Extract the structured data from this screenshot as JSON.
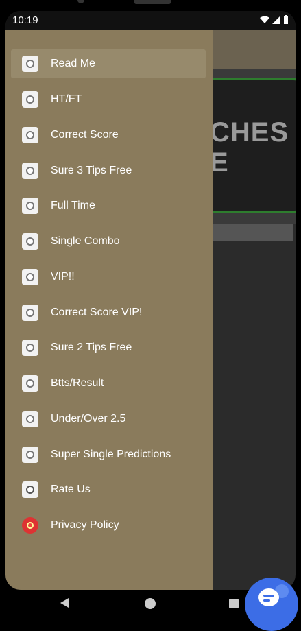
{
  "status_bar": {
    "time": "10:19",
    "wifi_icon": "wifi-icon",
    "signal_icon": "signal-icon",
    "battery_icon": "battery-icon"
  },
  "background": {
    "banner_text": "CHES\nE"
  },
  "drawer": {
    "items": [
      {
        "label": "Read Me",
        "icon": "read-icon",
        "active": true
      },
      {
        "label": "HT/FT",
        "icon": "ball-icon"
      },
      {
        "label": "Correct Score",
        "icon": "ball-icon"
      },
      {
        "label": "Sure 3 Tips Free",
        "icon": "ball-icon"
      },
      {
        "label": "Full Time",
        "icon": "ball-icon"
      },
      {
        "label": "Single Combo",
        "icon": "ball-icon"
      },
      {
        "label": "VIP!!",
        "icon": "ball-icon"
      },
      {
        "label": "Correct Score VIP!",
        "icon": "ball-icon"
      },
      {
        "label": "Sure 2 Tips Free",
        "icon": "ball-icon"
      },
      {
        "label": "Btts/Result",
        "icon": "ball-icon"
      },
      {
        "label": "Under/Over 2.5",
        "icon": "ball-icon"
      },
      {
        "label": "Super Single Predictions",
        "icon": "ball-icon"
      },
      {
        "label": "Rate Us",
        "icon": "rate-icon"
      },
      {
        "label": "Privacy Policy",
        "icon": "privacy-icon"
      }
    ]
  },
  "colors": {
    "drawer": "#8a7b5c",
    "fab": "#3c6de6"
  }
}
